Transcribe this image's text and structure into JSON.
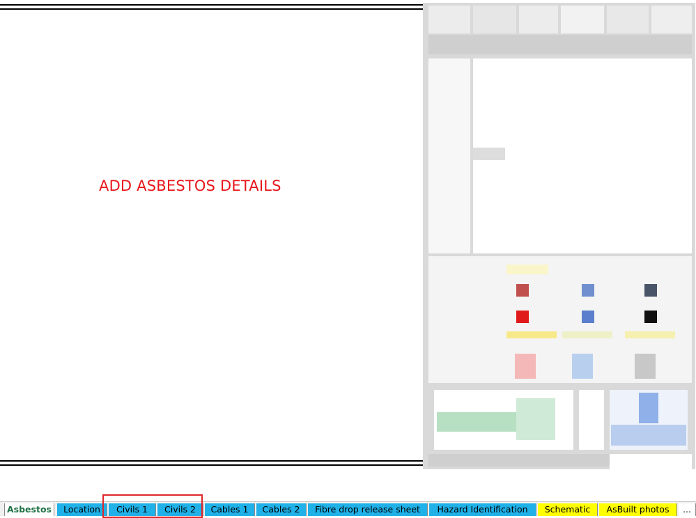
{
  "sheet": {
    "note": "ADD ASBESTOS DETAILS"
  },
  "tabs": [
    {
      "label": "Asbestos",
      "style": "active"
    },
    {
      "label": "Location",
      "style": "blue"
    },
    {
      "label": "Civils 1",
      "style": "blue"
    },
    {
      "label": "Civils 2",
      "style": "blue"
    },
    {
      "label": "Cables 1",
      "style": "blue"
    },
    {
      "label": "Cables 2",
      "style": "blue"
    },
    {
      "label": "Fibre drop release sheet",
      "style": "blue"
    },
    {
      "label": "Hazard Identification",
      "style": "blue"
    },
    {
      "label": "Schematic",
      "style": "yellow"
    },
    {
      "label": "AsBuilt photos",
      "style": "yellow"
    },
    {
      "label": "...",
      "style": "more"
    }
  ],
  "colors": {
    "note_red": "#e8161b",
    "tab_blue": "#1fb1e8",
    "tab_yellow": "#ffff00",
    "active_green": "#217346",
    "highlight_red": "#e0262a"
  }
}
